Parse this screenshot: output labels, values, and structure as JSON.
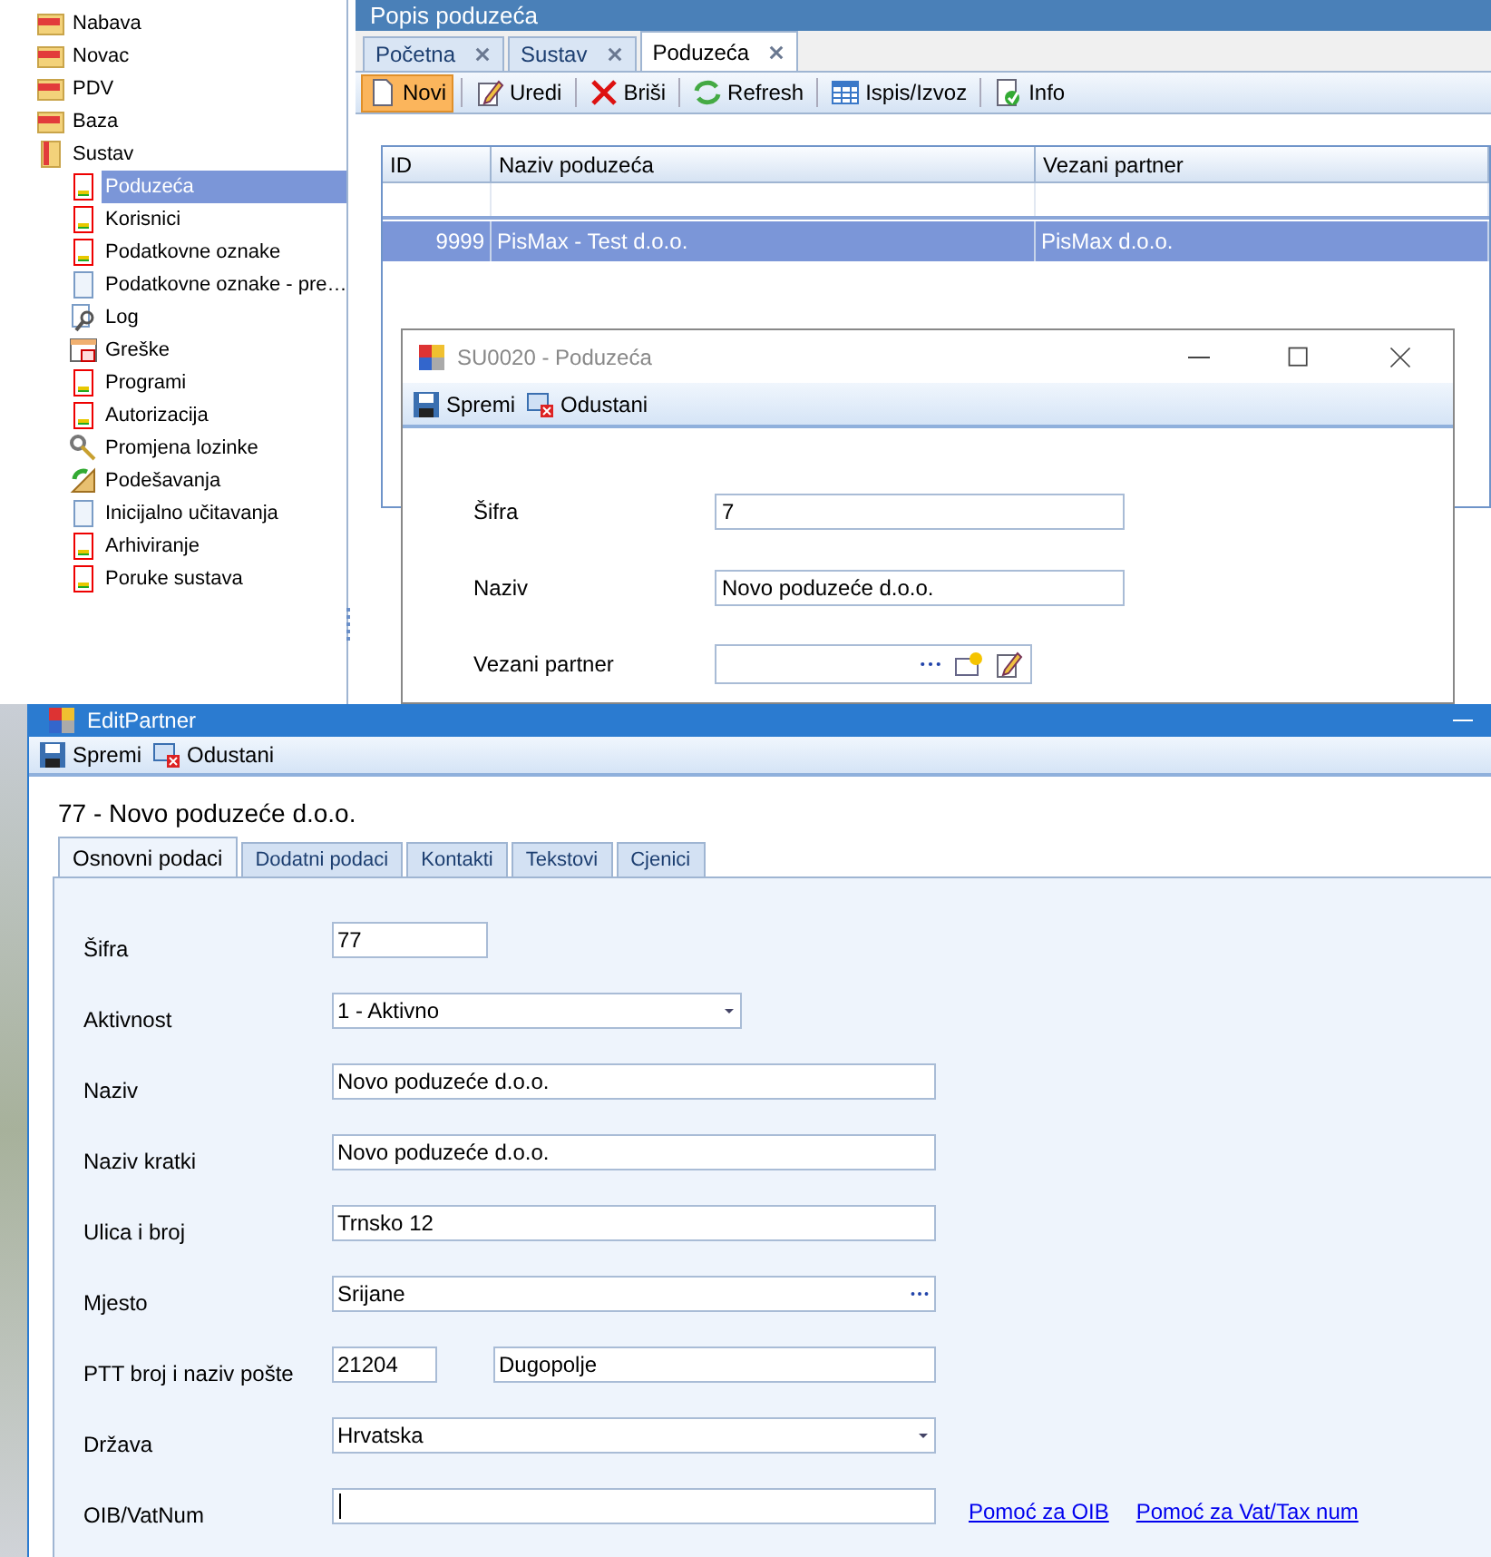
{
  "sidebar": {
    "items": [
      {
        "label": "Nabava",
        "kind": "folder",
        "expanded": false
      },
      {
        "label": "Novac",
        "kind": "folder",
        "expanded": false
      },
      {
        "label": "PDV",
        "kind": "folder",
        "expanded": false
      },
      {
        "label": "Baza",
        "kind": "folder",
        "expanded": false
      },
      {
        "label": "Sustav",
        "kind": "folder",
        "expanded": true,
        "children": [
          {
            "label": "Poduzeća",
            "kind": "form",
            "selected": true
          },
          {
            "label": "Korisnici",
            "kind": "form",
            "selected": false
          },
          {
            "label": "Podatkovne oznake",
            "kind": "form",
            "selected": false
          },
          {
            "label": "Podatkovne oznake - pre…",
            "kind": "doc",
            "selected": false
          },
          {
            "label": "Log",
            "kind": "log",
            "selected": false
          },
          {
            "label": "Greške",
            "kind": "errors",
            "selected": false
          },
          {
            "label": "Programi",
            "kind": "form",
            "selected": false
          },
          {
            "label": "Autorizacija",
            "kind": "form",
            "selected": false
          },
          {
            "label": "Promjena lozinke",
            "kind": "keys",
            "selected": false
          },
          {
            "label": "Podešavanja",
            "kind": "settings",
            "selected": false
          },
          {
            "label": "Inicijalno učitavanja",
            "kind": "doc",
            "selected": false
          },
          {
            "label": "Arhiviranje",
            "kind": "form",
            "selected": false
          },
          {
            "label": "Poruke sustava",
            "kind": "form",
            "selected": false
          }
        ]
      }
    ]
  },
  "main_window": {
    "title": "Popis poduzeća",
    "tabs": [
      {
        "label": "Početna",
        "selected": false
      },
      {
        "label": "Sustav",
        "selected": false
      },
      {
        "label": "Poduzeća",
        "selected": true
      }
    ],
    "toolbar": [
      {
        "label": "Novi",
        "kind": "new",
        "selected": true
      },
      {
        "label": "Uredi",
        "kind": "edit",
        "selected": false
      },
      {
        "label": "Briši",
        "kind": "delete",
        "selected": false
      },
      {
        "label": "Refresh",
        "kind": "refresh",
        "selected": false
      },
      {
        "label": "Ispis/Izvoz",
        "kind": "table",
        "selected": false
      },
      {
        "label": "Info",
        "kind": "info",
        "selected": false
      }
    ],
    "table": {
      "columns": [
        "ID",
        "Naziv poduzeća",
        "Vezani partner"
      ],
      "rows": [
        {
          "cells": [
            "9999",
            "PisMax - Test d.o.o.",
            "PisMax d.o.o."
          ],
          "selected": true
        }
      ]
    }
  },
  "dialog": {
    "title": "SU0020 - Poduzeća",
    "toolbar": [
      {
        "label": "Spremi",
        "kind": "save"
      },
      {
        "label": "Odustani",
        "kind": "cancel"
      }
    ],
    "fields": [
      {
        "label": "Šifra",
        "kind": "text",
        "value": "7"
      },
      {
        "label": "Naziv",
        "kind": "text",
        "value": "Novo poduzeće d.o.o."
      },
      {
        "label": "Vezani partner",
        "kind": "partner"
      }
    ]
  },
  "edit_partner": {
    "title": "EditPartner",
    "toolbar": [
      {
        "label": "Spremi",
        "kind": "save"
      },
      {
        "label": "Odustani",
        "kind": "cancel"
      }
    ],
    "heading": "77 - Novo poduzeće d.o.o.",
    "tabs": [
      {
        "label": "Osnovni podaci",
        "selected": true
      },
      {
        "label": "Dodatni podaci",
        "selected": false
      },
      {
        "label": "Kontakti",
        "selected": false
      },
      {
        "label": "Tekstovi",
        "selected": false
      },
      {
        "label": "Cjenici",
        "selected": false
      }
    ],
    "fields": [
      {
        "label": "Šifra",
        "kind": "short",
        "value": "77"
      },
      {
        "label": "Aktivnost",
        "kind": "combo",
        "value": "1 - Aktivno"
      },
      {
        "label": "Naziv",
        "kind": "text",
        "value": "Novo poduzeće d.o.o."
      },
      {
        "label": "Naziv kratki",
        "kind": "text",
        "value": "Novo poduzeće d.o.o."
      },
      {
        "label": "Ulica i broj",
        "kind": "text",
        "value": "Trnsko 12"
      },
      {
        "label": "Mjesto",
        "kind": "lookup",
        "value": "Srijane"
      },
      {
        "label": "PTT broj i naziv pošte",
        "kind": "postal",
        "value": "21204",
        "value_2": "Dugopolje"
      },
      {
        "label": "Država",
        "kind": "combo_wide",
        "value": "Hrvatska"
      },
      {
        "label": "OIB/VatNum",
        "kind": "text",
        "focused": true,
        "links": [
          "Pomoć za OIB",
          "Pomoć za Vat/Tax num"
        ]
      }
    ]
  }
}
